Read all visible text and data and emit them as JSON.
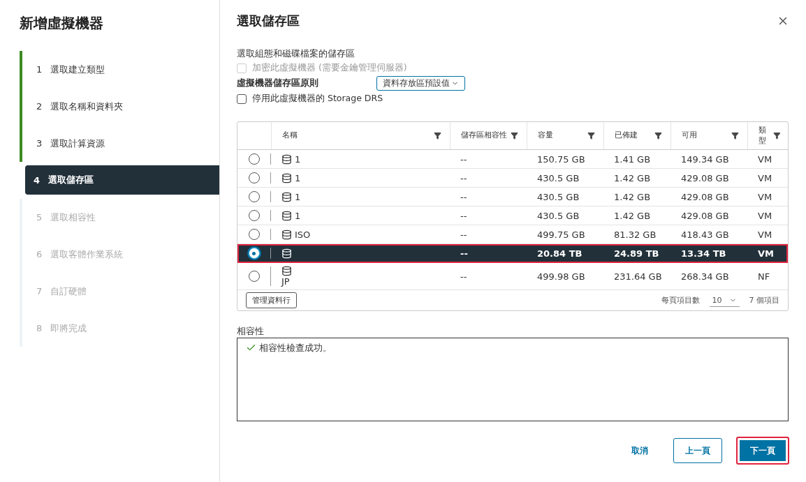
{
  "wizard": {
    "title": "新增虛擬機器",
    "steps": [
      {
        "number": "1",
        "label": "選取建立類型",
        "done": true,
        "selected": false,
        "disabled": false
      },
      {
        "number": "2",
        "label": "選取名稱和資料夾",
        "done": true,
        "selected": false,
        "disabled": false
      },
      {
        "number": "3",
        "label": "選取計算資源",
        "done": true,
        "selected": false,
        "disabled": false
      },
      {
        "number": "4",
        "label": "選取儲存區",
        "done": false,
        "selected": true,
        "disabled": false
      },
      {
        "number": "5",
        "label": "選取相容性",
        "done": false,
        "selected": false,
        "disabled": true
      },
      {
        "number": "6",
        "label": "選取客體作業系統",
        "done": false,
        "selected": false,
        "disabled": true
      },
      {
        "number": "7",
        "label": "自訂硬體",
        "done": false,
        "selected": false,
        "disabled": true
      },
      {
        "number": "8",
        "label": "即將完成",
        "done": false,
        "selected": false,
        "disabled": true
      }
    ]
  },
  "page": {
    "title": "選取儲存區",
    "subtitle": "選取組態和磁碟檔案的儲存區",
    "encrypt": {
      "label": "加密此虛擬機器 (需要金鑰管理伺服器)",
      "checked": false,
      "disabled": true
    },
    "policy": {
      "label": "虛擬機器儲存區原則",
      "value": "資料存放區預設值"
    },
    "drs": {
      "label": "停用此虛擬機器的 Storage DRS",
      "checked": false,
      "disabled": false
    },
    "table": {
      "columns": [
        "名稱",
        "儲存區相容性",
        "容量",
        "已佈建",
        "可用",
        "類型"
      ],
      "rows": [
        {
          "name": "1",
          "compat": "--",
          "capacity": "150.75 GB",
          "provisioned": "1.41 GB",
          "free": "149.34 GB",
          "type": "VM",
          "selected": false,
          "highlighted": false
        },
        {
          "name": "1",
          "compat": "--",
          "capacity": "430.5 GB",
          "provisioned": "1.42 GB",
          "free": "429.08 GB",
          "type": "VM",
          "selected": false,
          "highlighted": false
        },
        {
          "name": "1",
          "compat": "--",
          "capacity": "430.5 GB",
          "provisioned": "1.42 GB",
          "free": "429.08 GB",
          "type": "VM",
          "selected": false,
          "highlighted": false
        },
        {
          "name": "1",
          "compat": "--",
          "capacity": "430.5 GB",
          "provisioned": "1.42 GB",
          "free": "429.08 GB",
          "type": "VM",
          "selected": false,
          "highlighted": false
        },
        {
          "name": "ISO",
          "compat": "--",
          "capacity": "499.75 GB",
          "provisioned": "81.32 GB",
          "free": "418.43 GB",
          "type": "VM",
          "selected": false,
          "highlighted": false
        },
        {
          "compat": "--",
          "capacity": "20.84 TB",
          "provisioned": "24.89 TB",
          "free": "13.34 TB",
          "type": "VM",
          "selected": true,
          "highlighted": true
        },
        {
          "name_suffix": "JP",
          "compat": "--",
          "capacity": "499.98 GB",
          "provisioned": "231.64 GB",
          "free": "268.34 GB",
          "type": "NF",
          "selected": false,
          "highlighted": false
        }
      ],
      "manage_columns": "管理資料行",
      "per_page_label": "每頁項目數",
      "per_page": "10",
      "item_count": "7 個項目"
    },
    "compatibility": {
      "label": "相容性",
      "message": "相容性檢查成功。"
    }
  },
  "buttons": [
    {
      "kind": "link",
      "label": "取消",
      "highlighted": false
    },
    {
      "kind": "outline",
      "label": "上一頁",
      "highlighted": false
    },
    {
      "kind": "primary",
      "label": "下一頁",
      "highlighted": true
    }
  ]
}
